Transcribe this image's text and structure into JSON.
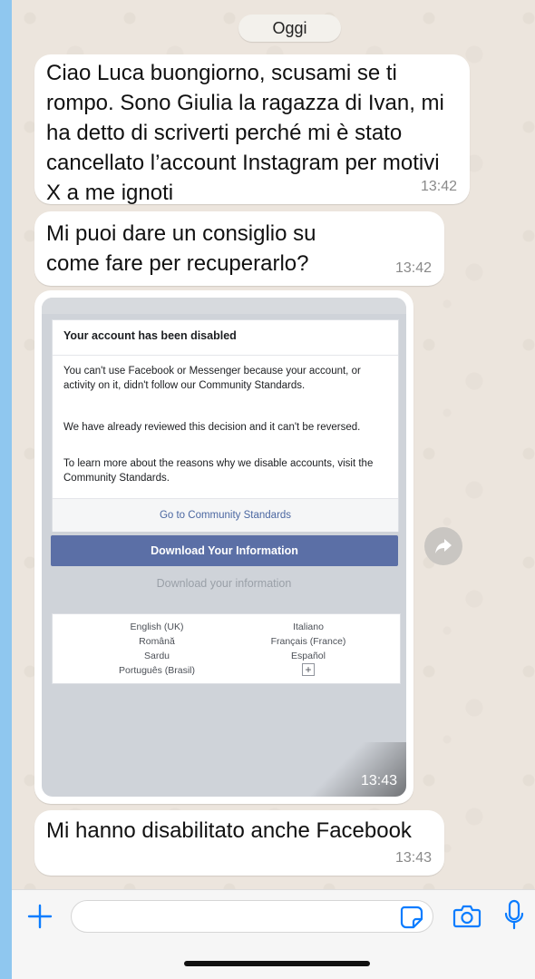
{
  "chat": {
    "date_label": "Oggi",
    "messages": [
      {
        "text": "Ciao Luca buongiorno, scusami se ti rompo. Sono Giulia la ragazza di Ivan, mi ha detto di scriverti perché mi è stato cancellato l’account Instagram per motivi X a me ignoti",
        "time": "13:42"
      },
      {
        "text": "Mi puoi dare un consiglio su come fare per recuperarlo?",
        "time": "13:42"
      },
      {
        "type": "image",
        "time": "13:43",
        "screenshot": {
          "title": "Your account has been disabled",
          "paragraphs": [
            "You can't use Facebook or Messenger because your account, or activity on it, didn't follow our Community Standards.",
            "We have already reviewed this decision and it can't be reversed.",
            "To learn more about the reasons why we disable accounts, visit the Community Standards."
          ],
          "footer_link": "Go to Community Standards",
          "download_button": "Download Your Information",
          "download_link": "Download your information",
          "languages_left": [
            "English (UK)",
            "Română",
            "Sardu",
            "Português (Brasil)"
          ],
          "languages_right": [
            "Italiano",
            "Français (France)",
            "Español"
          ],
          "more_languages": "+"
        }
      },
      {
        "text": "Mi hanno disabilitato anche Facebook",
        "time": "13:43"
      }
    ]
  },
  "input_bar": {
    "placeholder": "",
    "icons": [
      "plus-icon",
      "sticker-icon",
      "camera-icon",
      "microphone-icon"
    ]
  },
  "colors": {
    "chat_background": "#ece5dd",
    "bubble": "#ffffff",
    "accent": "#007aff",
    "fb_button": "#5b6fa6"
  }
}
